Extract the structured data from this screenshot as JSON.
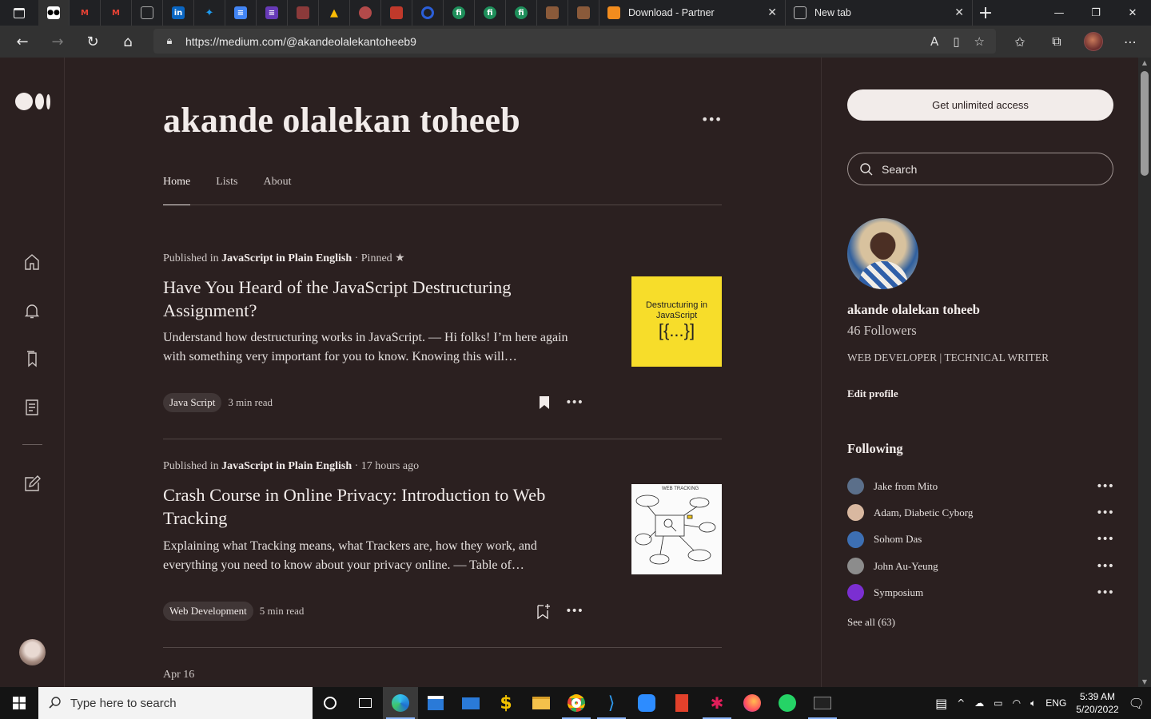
{
  "browser": {
    "tabs": [
      {
        "title": "Download - Partner",
        "close": "✕"
      },
      {
        "title": "New tab",
        "close": "✕"
      }
    ],
    "new_tab": "+",
    "url": "https://medium.com/@akandeolalekantoheeb9",
    "window": {
      "minimize": "—",
      "restore": "❐",
      "close": "✕"
    }
  },
  "profile": {
    "name": "akande olalekan toheeb",
    "more": "•••",
    "tabs": [
      "Home",
      "Lists",
      "About"
    ]
  },
  "stories": [
    {
      "published_prefix": "Published in",
      "publication": "JavaScript in Plain English",
      "suffix": " · Pinned ★",
      "title": "Have You Heard of the JavaScript Destructuring Assignment?",
      "excerpt": "Understand how destructuring works in JavaScript. — Hi folks! I’m here again with something very important for you to know. Knowing this will…",
      "tag": "Java Script",
      "read_time": "3 min read",
      "thumb_line1": "Destructuring in",
      "thumb_line2": "JavaScript",
      "thumb_line3": "[{...}]",
      "bookmarked": true
    },
    {
      "published_prefix": "Published in",
      "publication": "JavaScript in Plain English",
      "suffix": " · 17 hours ago",
      "title": "Crash Course in Online Privacy: Introduction to Web Tracking",
      "excerpt": "Explaining what Tracking means, what Trackers are, how they work, and everything you need to know about your privacy online. — Table of…",
      "tag": "Web Development",
      "read_time": "5 min read",
      "thumb_caption": "WEB TRACKING",
      "bookmarked": false
    }
  ],
  "next_date": "Apr 16",
  "sidebar": {
    "cta": "Get unlimited access",
    "search_placeholder": "Search",
    "name": "akande olalekan toheeb",
    "followers": "46 Followers",
    "bio": "WEB DEVELOPER | TECHNICAL WRITER",
    "edit_profile": "Edit profile",
    "following_heading": "Following",
    "following": [
      {
        "name": "Jake from Mito",
        "color": "#5b6f8a"
      },
      {
        "name": "Adam, Diabetic Cyborg",
        "color": "#d9b8a0"
      },
      {
        "name": "Sohom Das",
        "color": "#3d6fb3"
      },
      {
        "name": "John Au-Yeung",
        "color": "#8c8c8c"
      },
      {
        "name": "Symposium",
        "color": "#7b2fd1"
      }
    ],
    "row_more": "•••",
    "see_all": "See all (63)"
  },
  "taskbar": {
    "search_placeholder": "Type here to search",
    "lang": "ENG",
    "time": "5:39 AM",
    "date": "5/20/2022"
  }
}
